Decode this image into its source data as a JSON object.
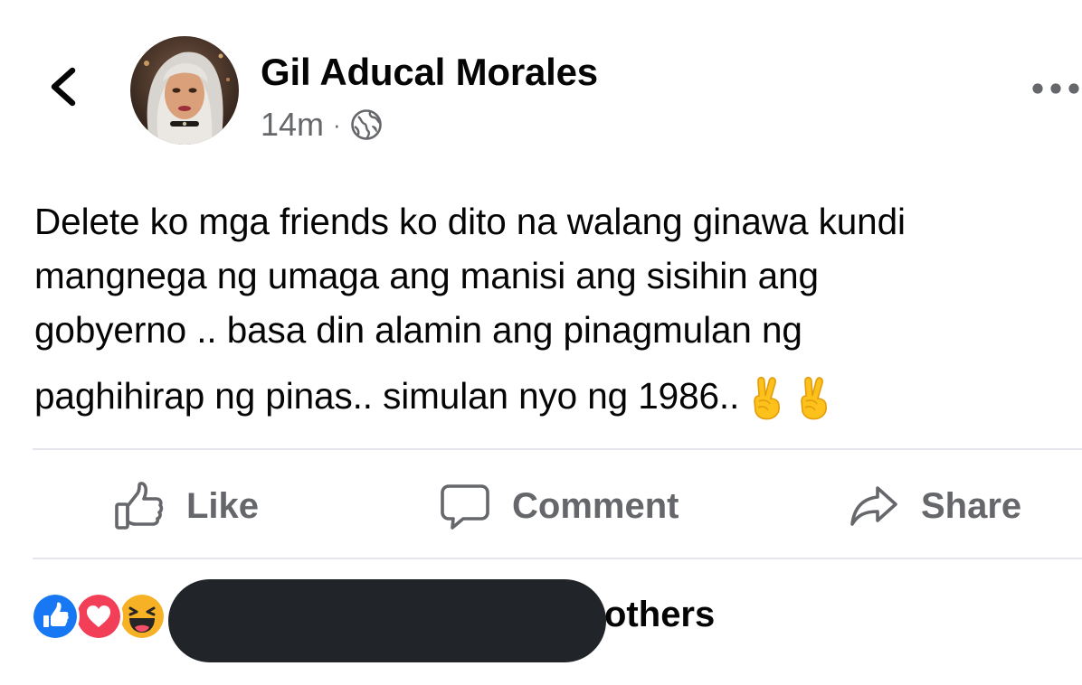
{
  "post": {
    "author_name": "Gil Aducal Morales",
    "timestamp": "14m",
    "separator": "·",
    "audience_icon": "globe-icon",
    "text_lines": [
      "Delete ko mga friends ko dito na walang ginawa kundi",
      "mangnega ng umaga ang manisi ang sisihin ang",
      "gobyerno .. basa din alamin ang pinagmulan ng",
      "paghihirap ng pinas.. simulan nyo ng 1986.."
    ],
    "trailing_emojis": [
      "victory-hand-emoji",
      "victory-hand-emoji"
    ]
  },
  "header": {
    "back_icon": "chevron-left-icon",
    "more_icon": "more-dots-icon"
  },
  "actions": {
    "like_label": "Like",
    "comment_label": "Comment",
    "share_label": "Share"
  },
  "reactions": {
    "types": [
      "like",
      "love",
      "haha"
    ],
    "count_text": "others"
  },
  "colors": {
    "text_primary": "#050505",
    "text_secondary": "#65676b",
    "like_blue": "#1877f2",
    "love_red": "#f33e58",
    "haha_yellow": "#f7b125",
    "divider": "#e4e6eb",
    "redaction": "#212428"
  }
}
